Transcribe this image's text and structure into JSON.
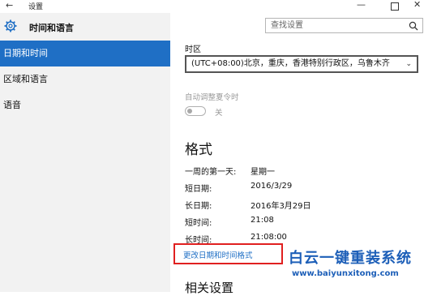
{
  "titlebar": {
    "back_glyph": "←",
    "title": "设置",
    "min_glyph": "—",
    "close_glyph": "✕"
  },
  "sidebar": {
    "title": "时间和语言",
    "items": [
      {
        "label": "日期和时间",
        "active": true
      },
      {
        "label": "区域和语言",
        "active": false
      },
      {
        "label": "语音",
        "active": false
      }
    ]
  },
  "search": {
    "placeholder": "查找设置"
  },
  "timezone": {
    "label": "时区",
    "value": "(UTC+08:00)北京，重庆，香港特别行政区，乌鲁木齐"
  },
  "dst": {
    "label": "自动调整夏令时",
    "state": "关",
    "enabled": false
  },
  "formats": {
    "heading": "格式",
    "rows": [
      {
        "label": "一周的第一天:",
        "value": "星期一"
      },
      {
        "label": "短日期:",
        "value": "2016/3/29"
      },
      {
        "label": "长日期:",
        "value": "2016年3月29日"
      },
      {
        "label": "短时间:",
        "value": "21:08"
      },
      {
        "label": "长时间:",
        "value": "21:08:00"
      }
    ],
    "change_link": "更改日期和时间格式"
  },
  "related": {
    "heading": "相关设置"
  },
  "watermark": {
    "text": "白云一键重装系统",
    "url": "www.baiyunxitong.com"
  },
  "colors": {
    "accent": "#1f6fc5",
    "highlight_box": "#e02020",
    "sidebar_bg": "#f2f2f2"
  }
}
